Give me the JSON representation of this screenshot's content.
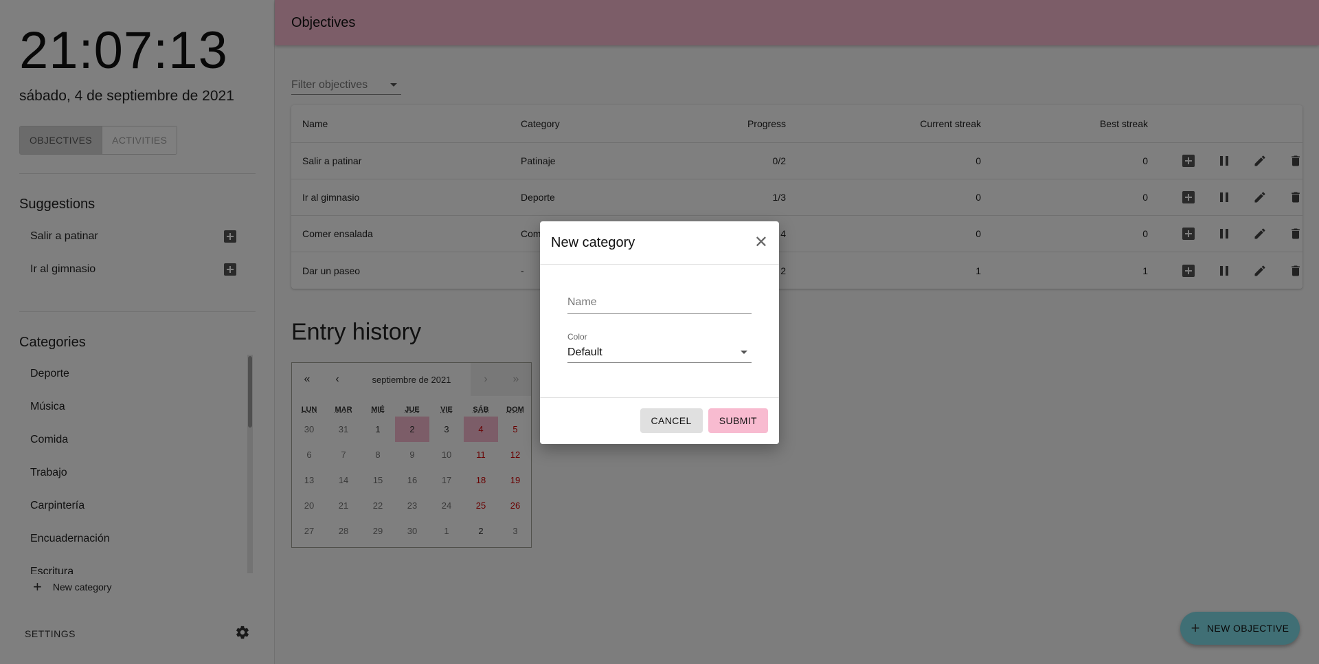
{
  "sidebar": {
    "clock": "21:07:13",
    "date": "sábado, 4 de septiembre de 2021",
    "tabs": [
      {
        "label": "OBJECTIVES"
      },
      {
        "label": "ACTIVITIES"
      }
    ],
    "suggestions_title": "Suggestions",
    "suggestions": [
      {
        "label": "Salir a patinar"
      },
      {
        "label": "Ir al gimnasio"
      }
    ],
    "categories_title": "Categories",
    "categories": [
      {
        "label": "Deporte"
      },
      {
        "label": "Música"
      },
      {
        "label": "Comida"
      },
      {
        "label": "Trabajo"
      },
      {
        "label": "Carpintería"
      },
      {
        "label": "Encuadernación"
      },
      {
        "label": "Escritura"
      }
    ],
    "new_category_label": "New category",
    "settings_label": "SETTINGS"
  },
  "header": {
    "title": "Objectives"
  },
  "filter": {
    "placeholder": "Filter objectives"
  },
  "table": {
    "columns": [
      "Name",
      "Category",
      "Progress",
      "Current streak",
      "Best streak"
    ],
    "rows": [
      {
        "name": "Salir a patinar",
        "category": "Patinaje",
        "progress": "0/2",
        "current": "0",
        "best": "0"
      },
      {
        "name": "Ir al gimnasio",
        "category": "Deporte",
        "progress": "1/3",
        "current": "0",
        "best": "0"
      },
      {
        "name": "Comer ensalada",
        "category": "Com",
        "progress": "4",
        "current": "0",
        "best": "0"
      },
      {
        "name": "Dar un paseo",
        "category": "-",
        "progress": "2",
        "current": "1",
        "best": "1"
      }
    ]
  },
  "history": {
    "title": "Entry history",
    "calendar": {
      "nav_first": "«",
      "nav_prev": "‹",
      "nav_next": "›",
      "nav_last": "»",
      "month_label": "septiembre de 2021",
      "weekdays": [
        "LUN",
        "MAR",
        "MIÉ",
        "JUE",
        "VIE",
        "SÁB",
        "DOM"
      ],
      "days": [
        {
          "d": "30",
          "other": true
        },
        {
          "d": "31",
          "other": true
        },
        {
          "d": "1"
        },
        {
          "d": "2",
          "active": true
        },
        {
          "d": "3"
        },
        {
          "d": "4",
          "active": true,
          "weekend": true
        },
        {
          "d": "5",
          "weekend": true
        },
        {
          "d": "6",
          "other": true
        },
        {
          "d": "7",
          "other": true
        },
        {
          "d": "8",
          "other": true
        },
        {
          "d": "9",
          "other": true
        },
        {
          "d": "10",
          "other": true
        },
        {
          "d": "11",
          "weekend": true
        },
        {
          "d": "12",
          "weekend": true
        },
        {
          "d": "13",
          "other": true
        },
        {
          "d": "14",
          "other": true
        },
        {
          "d": "15",
          "other": true
        },
        {
          "d": "16",
          "other": true
        },
        {
          "d": "17",
          "other": true
        },
        {
          "d": "18",
          "weekend": true
        },
        {
          "d": "19",
          "weekend": true
        },
        {
          "d": "20",
          "other": true
        },
        {
          "d": "21",
          "other": true
        },
        {
          "d": "22",
          "other": true
        },
        {
          "d": "23",
          "other": true
        },
        {
          "d": "24",
          "other": true
        },
        {
          "d": "25",
          "weekend": true
        },
        {
          "d": "26",
          "weekend": true
        },
        {
          "d": "27",
          "other": true
        },
        {
          "d": "28",
          "other": true
        },
        {
          "d": "29",
          "other": true
        },
        {
          "d": "30",
          "other": true
        },
        {
          "d": "1",
          "other": true
        },
        {
          "d": "2"
        },
        {
          "d": "3",
          "other": true
        }
      ]
    }
  },
  "fab": {
    "label": "NEW OBJECTIVE"
  },
  "dialog": {
    "title": "New category",
    "name_placeholder": "Name",
    "color_label": "Color",
    "color_value": "Default",
    "cancel": "CANCEL",
    "submit": "SUBMIT"
  },
  "colors": {
    "accent": "#f8bbd0",
    "fab": "#80deea",
    "weekend": "#d10000"
  }
}
